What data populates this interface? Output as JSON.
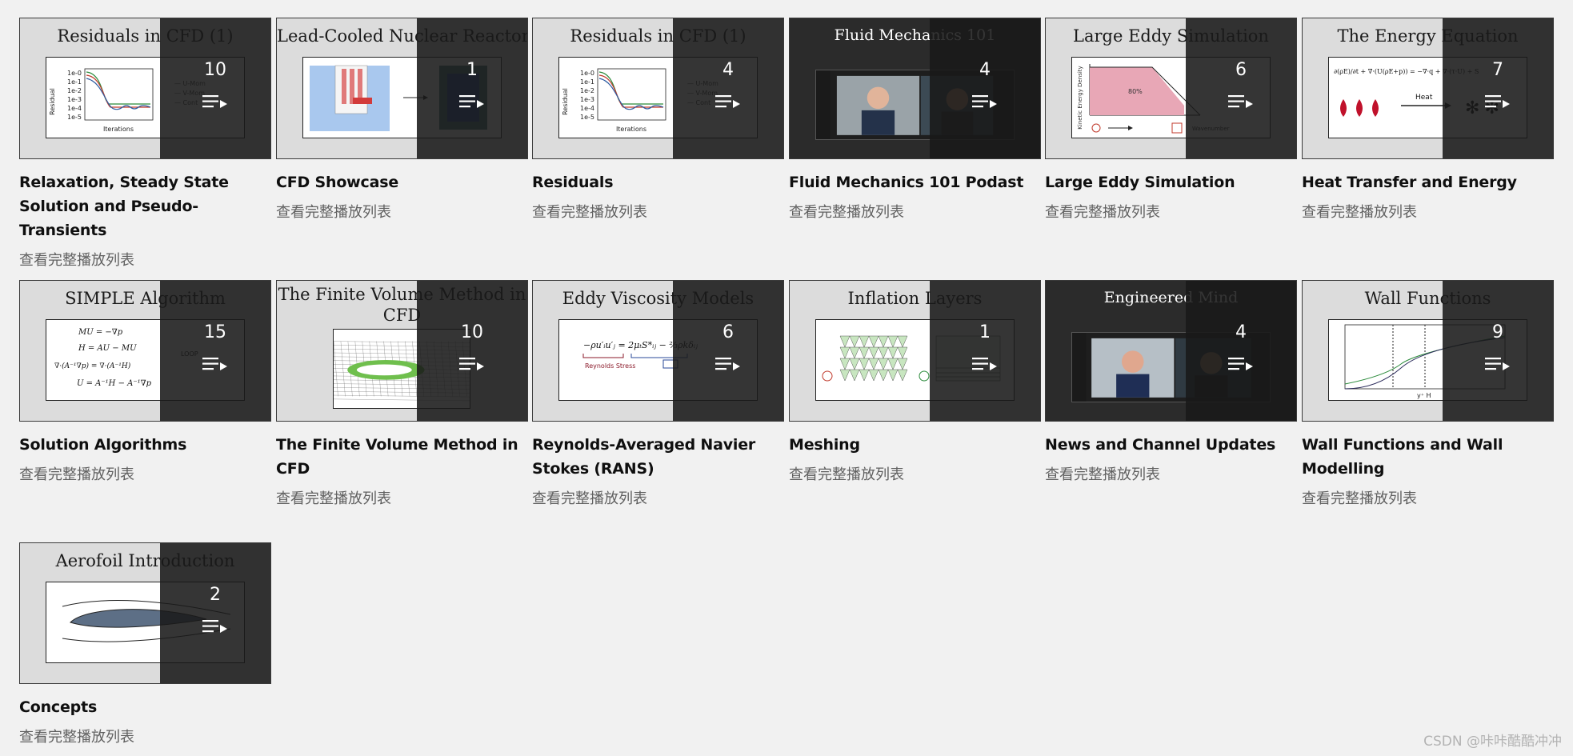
{
  "playlists": [
    {
      "thumb_title": "Residuals in CFD (1)",
      "count": "10",
      "title": "Relaxation, Steady State Solution and Pseudo-Transients",
      "link": "查看完整播放列表",
      "style": "light",
      "art": "residuals"
    },
    {
      "thumb_title": "Lead-Cooled Nuclear Reactor",
      "count": "1",
      "title": "CFD Showcase",
      "link": "查看完整播放列表",
      "style": "light",
      "art": "reactor"
    },
    {
      "thumb_title": "Residuals in CFD (1)",
      "count": "4",
      "title": "Residuals",
      "link": "查看完整播放列表",
      "style": "light",
      "art": "residuals"
    },
    {
      "thumb_title": "Fluid Mechanics 101",
      "count": "4",
      "title": "Fluid Mechanics 101 Podast",
      "link": "查看完整播放列表",
      "style": "dark",
      "art": "podcast"
    },
    {
      "thumb_title": "Large Eddy Simulation",
      "count": "6",
      "title": "Large Eddy Simulation",
      "link": "查看完整播放列表",
      "style": "light",
      "art": "les"
    },
    {
      "thumb_title": "The Energy Equation",
      "count": "7",
      "title": "Heat Transfer and Energy",
      "link": "查看完整播放列表",
      "style": "light",
      "art": "energy"
    },
    {
      "thumb_title": "SIMPLE Algorithm",
      "count": "15",
      "title": "Solution Algorithms",
      "link": "查看完整播放列表",
      "style": "light",
      "art": "simple"
    },
    {
      "thumb_title": "The Finite Volume Method in CFD",
      "count": "10",
      "title": "The Finite Volume Method in CFD",
      "link": "查看完整播放列表",
      "style": "light",
      "art": "mesh"
    },
    {
      "thumb_title": "Eddy Viscosity Models",
      "count": "6",
      "title": "Reynolds-Averaged Navier Stokes (RANS)",
      "link": "查看完整播放列表",
      "style": "light",
      "art": "eddy"
    },
    {
      "thumb_title": "Inflation Layers",
      "count": "1",
      "title": "Meshing",
      "link": "查看完整播放列表",
      "style": "light",
      "art": "inflation"
    },
    {
      "thumb_title": "Engineered Mind",
      "count": "4",
      "title": "News and Channel Updates",
      "link": "查看完整播放列表",
      "style": "dark",
      "art": "podcast2"
    },
    {
      "thumb_title": "Wall Functions",
      "count": "9",
      "title": "Wall Functions and Wall Modelling",
      "link": "查看完整播放列表",
      "style": "light",
      "art": "wall"
    },
    {
      "thumb_title": "Aerofoil Introduction",
      "count": "2",
      "title": "Concepts",
      "link": "查看完整播放列表",
      "style": "light",
      "art": "aerofoil"
    }
  ],
  "slide_text": {
    "residual_axis": "Residual",
    "iterations": "Iterations",
    "residual_ticks": [
      "1e-0",
      "1e-1",
      "1e-2",
      "1e-3",
      "1e-4",
      "1e-5"
    ],
    "legend": [
      "U-Mom",
      "V-Mom",
      "Cont"
    ],
    "heat": "Heat",
    "loop": "LOOP",
    "reynolds": "Reynolds Stress",
    "les_pct": "80%",
    "les_ylabel": "Kinetic Energy Density",
    "les_xlabel": "Wavenumber",
    "wall_xlabel": "y⁺ H"
  },
  "watermark": "CSDN @咔咔酷酷冲冲",
  "colors": {
    "overlay": "rgba(25,25,25,0.88)",
    "title": "#0f0f0f",
    "link": "#606060"
  }
}
